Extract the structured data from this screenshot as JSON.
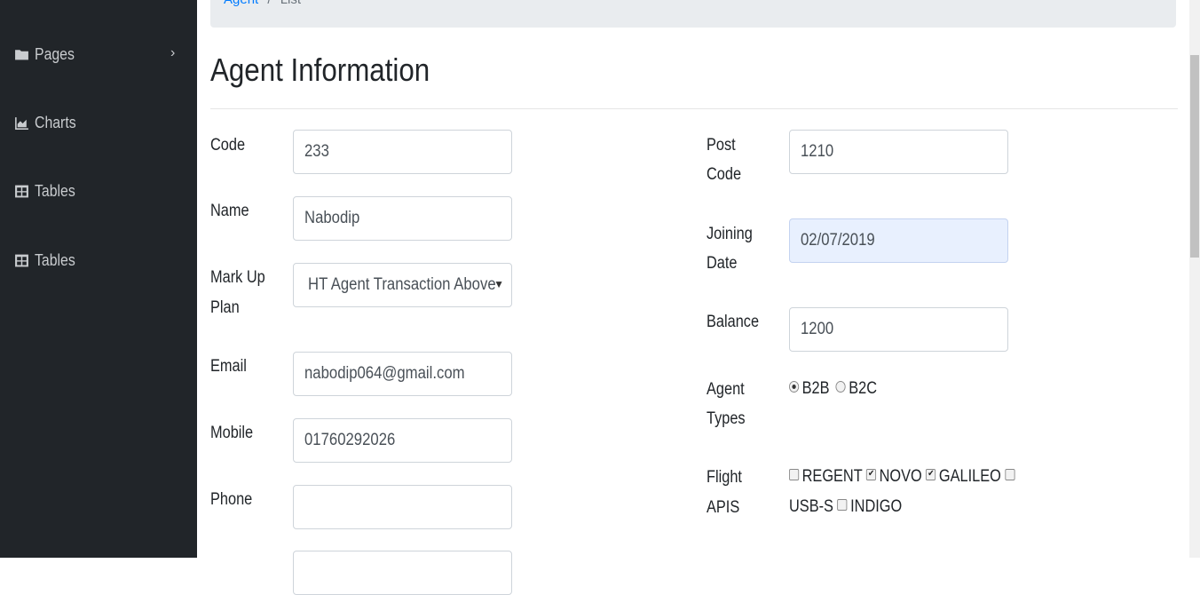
{
  "breadcrumb": {
    "item1": "Agent",
    "separator": "/",
    "item2": "List"
  },
  "sidebar": {
    "items": [
      {
        "label": "Pages",
        "icon": "folder-icon",
        "has_chevron": true
      },
      {
        "label": "Charts",
        "icon": "area-chart-icon"
      },
      {
        "label": "Tables",
        "icon": "table-icon"
      },
      {
        "label": "Tables",
        "icon": "table-icon"
      }
    ],
    "chevron": "›"
  },
  "page": {
    "title": "Agent Information"
  },
  "form": {
    "code": {
      "label": "Code",
      "value": "233"
    },
    "name": {
      "label": "Name",
      "value": "Nabodip"
    },
    "markup": {
      "label_line1": "Mark Up",
      "label_line2": "Plan",
      "value": "HT Agent Transaction Above"
    },
    "email": {
      "label": "Email",
      "value": "nabodip064@gmail.com"
    },
    "mobile": {
      "label": "Mobile",
      "value": "01760292026"
    },
    "phone": {
      "label": "Phone",
      "value": ""
    },
    "postcode": {
      "label_line1": "Post",
      "label_line2": "Code",
      "value": "1210"
    },
    "joining": {
      "label_line1": "Joining",
      "label_line2": "Date",
      "value": "02/07/2019"
    },
    "balance": {
      "label": "Balance",
      "value": "1200"
    },
    "agent_types": {
      "label_line1": "Agent",
      "label_line2": "Types",
      "options": [
        {
          "label": "B2B",
          "checked": true
        },
        {
          "label": "B2C",
          "checked": false
        }
      ]
    },
    "flight_apis": {
      "label_line1": "Flight",
      "label_line2": "APIS",
      "options": [
        {
          "label": "REGENT",
          "checked": false
        },
        {
          "label": "NOVO",
          "checked": true
        },
        {
          "label": "GALILEO",
          "checked": true
        },
        {
          "label": "USB-S",
          "checked": false
        },
        {
          "label": "INDIGO",
          "checked": false
        }
      ]
    }
  },
  "colors": {
    "sidebar": "#212529",
    "link": "#007bff",
    "autofill": "#e8f0fe"
  }
}
